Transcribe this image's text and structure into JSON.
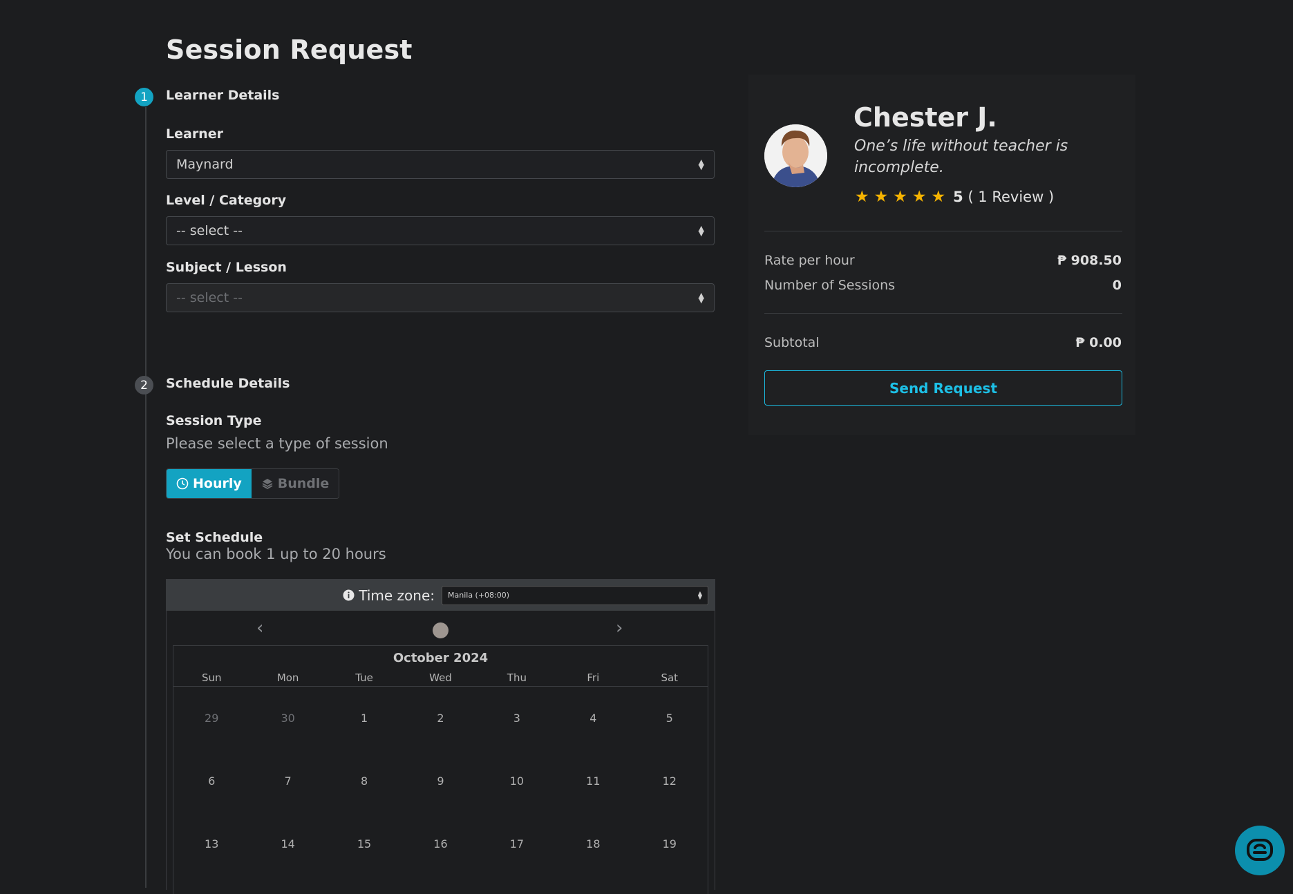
{
  "page": {
    "title": "Session Request"
  },
  "learner_details": {
    "step_number": "1",
    "title": "Learner Details",
    "learner": {
      "label": "Learner",
      "value": "Maynard"
    },
    "level": {
      "label": "Level / Category",
      "value": "-- select --"
    },
    "subject": {
      "label": "Subject / Lesson",
      "value": "-- select --"
    }
  },
  "schedule_details": {
    "step_number": "2",
    "title": "Schedule Details",
    "session_type": {
      "label": "Session Type",
      "hint": "Please select a type of session",
      "options": [
        {
          "label": "Hourly",
          "icon": "clock-icon",
          "active": true
        },
        {
          "label": "Bundle",
          "icon": "layers-icon",
          "active": false
        }
      ]
    },
    "set_schedule": {
      "label": "Set Schedule",
      "hint": "You can book 1 up to 20 hours"
    },
    "timezone": {
      "label": "Time zone:",
      "value": "Manila (+08:00)"
    },
    "calendar": {
      "month": "October 2024",
      "weekdays": [
        "Sun",
        "Mon",
        "Tue",
        "Wed",
        "Thu",
        "Fri",
        "Sat"
      ],
      "weeks": [
        [
          "29",
          "30",
          "1",
          "2",
          "3",
          "4",
          "5"
        ],
        [
          "6",
          "7",
          "8",
          "9",
          "10",
          "11",
          "12"
        ],
        [
          "13",
          "14",
          "15",
          "16",
          "17",
          "18",
          "19"
        ]
      ]
    }
  },
  "tutor": {
    "name": "Chester J.",
    "quote": "One’s life without teacher is incomplete.",
    "rating": "5",
    "reviews": "( 1 Review )"
  },
  "summary": {
    "rate_label": "Rate per hour",
    "rate_value": "₱ 908.50",
    "sessions_label": "Number of Sessions",
    "sessions_value": "0",
    "subtotal_label": "Subtotal",
    "subtotal_value": "₱ 0.00",
    "send_label": "Send Request"
  },
  "colors": {
    "accent": "#13a3c2",
    "star": "#f5b301",
    "background": "#1c1d1f"
  }
}
